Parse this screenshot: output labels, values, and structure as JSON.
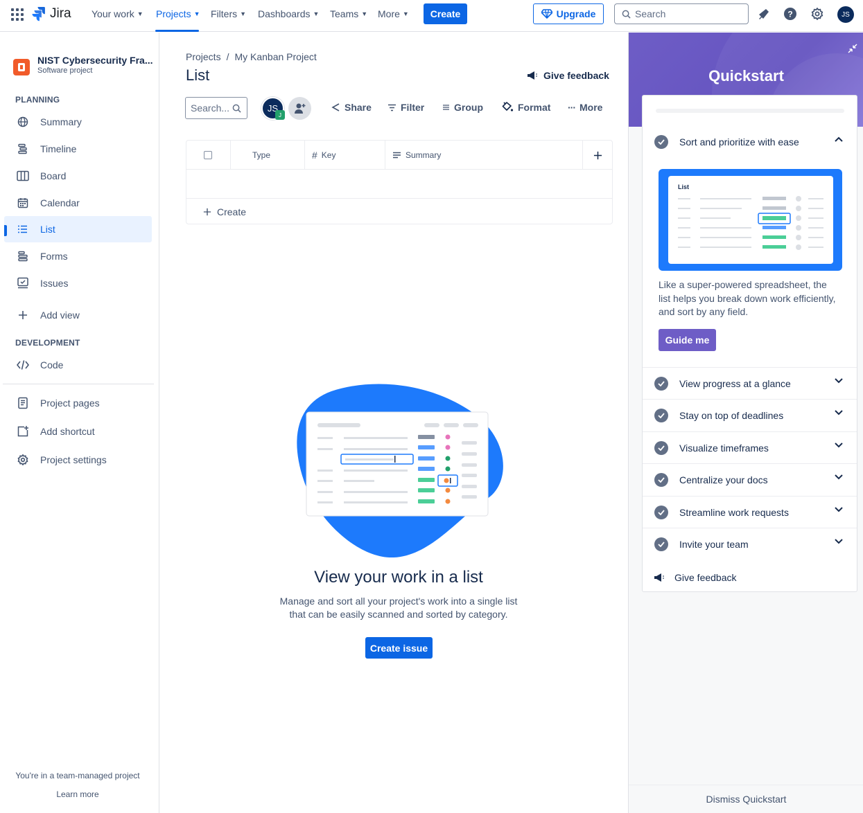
{
  "topnav": {
    "app_name": "Jira",
    "items": [
      {
        "label": "Your work"
      },
      {
        "label": "Projects"
      },
      {
        "label": "Filters"
      },
      {
        "label": "Dashboards"
      },
      {
        "label": "Teams"
      },
      {
        "label": "More"
      }
    ],
    "active_item": "Projects",
    "create_label": "Create",
    "upgrade_label": "Upgrade",
    "search_placeholder": "Search",
    "avatar_initials": "JS",
    "icons": [
      "app-switcher-icon",
      "notifications-icon",
      "help-icon",
      "settings-icon"
    ]
  },
  "sidebar": {
    "project_name": "NIST Cybersecurity Fra...",
    "project_type": "Software project",
    "planning_label": "PLANNING",
    "planning_items": [
      {
        "label": "Summary",
        "icon": "globe-icon"
      },
      {
        "label": "Timeline",
        "icon": "timeline-icon"
      },
      {
        "label": "Board",
        "icon": "board-icon"
      },
      {
        "label": "Calendar",
        "icon": "calendar-icon"
      },
      {
        "label": "List",
        "icon": "list-icon",
        "active": true
      },
      {
        "label": "Forms",
        "icon": "forms-icon"
      },
      {
        "label": "Issues",
        "icon": "issues-icon"
      }
    ],
    "add_view_label": "Add view",
    "development_label": "DEVELOPMENT",
    "code_label": "Code",
    "project_pages_label": "Project pages",
    "add_shortcut_label": "Add shortcut",
    "project_settings_label": "Project settings",
    "footer_text": "You're in a team-managed project",
    "learn_more_label": "Learn more"
  },
  "main": {
    "breadcrumb": [
      "Projects",
      "/",
      "My Kanban Project"
    ],
    "title": "List",
    "give_feedback_label": "Give feedback",
    "search_placeholder": "Search...",
    "avatar_initials": "JS",
    "avatar_badge": "J",
    "toolbar": {
      "share": "Share",
      "filter": "Filter",
      "group": "Group",
      "format": "Format",
      "more": "More"
    },
    "columns": [
      "Type",
      "Key",
      "Summary"
    ],
    "create_row_label": "Create",
    "empty_title": "View your work in a list",
    "empty_desc": "Manage and sort all your project's work into a single list that can be easily scanned and sorted by category.",
    "create_issue_label": "Create issue"
  },
  "quickstart": {
    "title": "Quickstart",
    "expanded_item": "Sort and prioritize with ease",
    "illustration_label": "List",
    "body": "Like a super-powered spreadsheet, the list helps you break down work efficiently, and sort by any field.",
    "guide_label": "Guide me",
    "items": [
      "View progress at a glance",
      "Stay on top of deadlines",
      "Visualize timeframes",
      "Centralize your docs",
      "Streamline work requests",
      "Invite your team"
    ],
    "feedback_label": "Give feedback",
    "dismiss_label": "Dismiss Quickstart"
  },
  "colors": {
    "brand_blue": "#0c66e4",
    "quickstart_purple": "#6e5dc6",
    "illustration_blue": "#1d7afc",
    "text_primary": "#172b4d",
    "text_subtle": "#44546f"
  }
}
